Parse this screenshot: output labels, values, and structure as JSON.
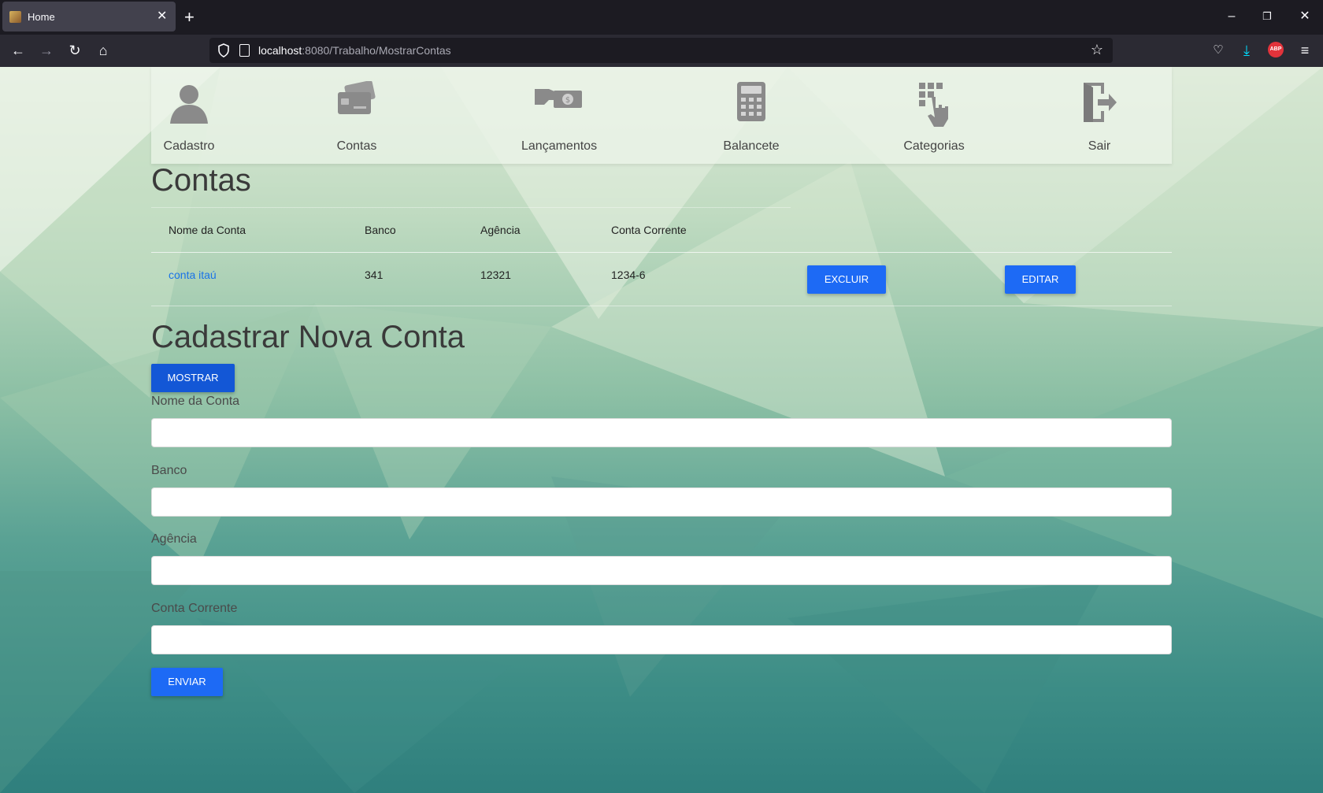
{
  "browser": {
    "tab_title": "Home",
    "url_host": "localhost",
    "url_rest": ":8080/Trabalho/MostrarContas",
    "abp_label": "ABP"
  },
  "menu": {
    "items": [
      {
        "label": "Cadastro",
        "icon": "user-icon"
      },
      {
        "label": "Contas",
        "icon": "card-icon"
      },
      {
        "label": "Lançamentos",
        "icon": "money-hand-icon"
      },
      {
        "label": "Balancete",
        "icon": "calculator-icon"
      },
      {
        "label": "Categorias",
        "icon": "grid-hand-icon"
      },
      {
        "label": "Sair",
        "icon": "logout-icon"
      }
    ]
  },
  "contas": {
    "title": "Contas",
    "columns": [
      "Nome da Conta",
      "Banco",
      "Agência",
      "Conta Corrente"
    ],
    "rows": [
      {
        "nome": "conta itaú",
        "banco": "341",
        "agencia": "12321",
        "conta": "1234-6",
        "excluir": "EXCLUIR",
        "editar": "EDITAR"
      }
    ]
  },
  "form": {
    "title": "Cadastrar Nova Conta",
    "toggle_label": "MOSTRAR",
    "fields": [
      {
        "label": "Nome da Conta",
        "value": ""
      },
      {
        "label": "Banco",
        "value": ""
      },
      {
        "label": "Agência",
        "value": ""
      },
      {
        "label": "Conta Corrente",
        "value": ""
      }
    ],
    "submit_label": "ENVIAR"
  },
  "colors": {
    "primary_button": "#1d6af5",
    "link": "#1a73e8"
  }
}
